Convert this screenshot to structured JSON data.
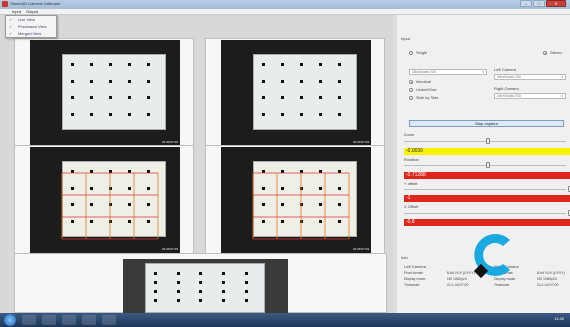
{
  "window": {
    "title": "Stereo3D Camera Calibrator",
    "buttons": [
      "–",
      "□",
      "✕"
    ]
  },
  "menu": {
    "input": "Input",
    "output": "Output"
  },
  "view_menu": {
    "items": [
      {
        "label": "Live View",
        "checked": true
      },
      {
        "label": "Processed View",
        "checked": true
      },
      {
        "label": "Merged View",
        "checked": true
      }
    ]
  },
  "cameras": {
    "top_left_time": "01:46:07:03",
    "top_right_time": "01:46:07:03",
    "mid_left_time": "01:46:07:03",
    "mid_right_time": "01:46:07:03"
  },
  "panel": {
    "input_label": "Input",
    "single": "Single",
    "stereo": "Stereo",
    "identical": "Identical",
    "under_over": "Under/Over",
    "side_by_side": "Side by Side",
    "left_camera": "Left Camera",
    "right_camera": "Right Camera",
    "device_a": "UltraStudio SDI",
    "device_b": "UltraStudio SDI",
    "device_c": "UltraStudio SDI",
    "stop_capture": "Stop capture",
    "zoom": "Zoom",
    "zoom_value": "-0.0039",
    "rotation": "Rotation",
    "rotation_value": "-0.71288",
    "yoffset": "Y offset",
    "yoffset_value": "-1",
    "xoffset": "X Offset",
    "xoffset_value": "-0.8"
  },
  "info": {
    "title": "Info",
    "left_header": "Left Camera",
    "right_header": "Right Camera",
    "rows": [
      {
        "k": "Pixel format:",
        "l": "8-bit YUV (UYVY)",
        "r": "8-bit YUV (UYVY)"
      },
      {
        "k": "Display mode:",
        "l": "HD 1080p24",
        "r": "HD 1080p24"
      },
      {
        "k": "Timecode:",
        "l": "01:1:44:07:00",
        "r": "01:1:44:07:00"
      }
    ]
  },
  "taskbar": {
    "clock": "11:40"
  },
  "colors": {
    "yellow": "#f6f200",
    "red": "#e0261b",
    "logo": "#1aa9e1"
  }
}
